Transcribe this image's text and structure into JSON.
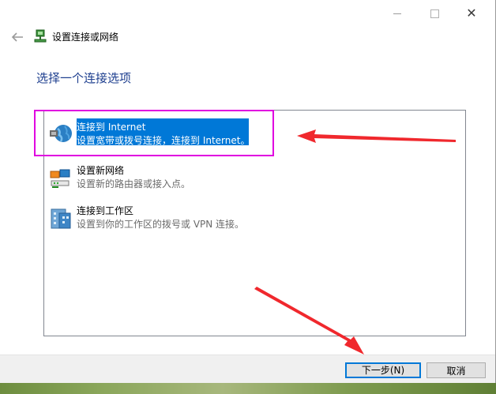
{
  "window": {
    "title": "设置连接或网络",
    "controls": {
      "minimize": "minimize",
      "maximize": "maximize",
      "close": "✕"
    }
  },
  "header": {
    "back_icon": "back-arrow-icon",
    "title": "设置连接或网络"
  },
  "instruction": "选择一个连接选项",
  "options": [
    {
      "title": "连接到 Internet",
      "desc": "设置宽带或拨号连接，连接到 Internet。",
      "icon": "globe-network-icon",
      "selected": true
    },
    {
      "title": "设置新网络",
      "desc": "设置新的路由器或接入点。",
      "icon": "router-setup-icon",
      "selected": false
    },
    {
      "title": "连接到工作区",
      "desc": "设置到你的工作区的拨号或 VPN 连接。",
      "icon": "workplace-building-icon",
      "selected": false
    }
  ],
  "buttons": {
    "next": "下一步(N)",
    "cancel": "取消"
  },
  "colors": {
    "accent": "#0078d7",
    "instruction": "#1e3f8f",
    "annotation_box": "#e000e0",
    "annotation_arrow": "#f0282d"
  }
}
